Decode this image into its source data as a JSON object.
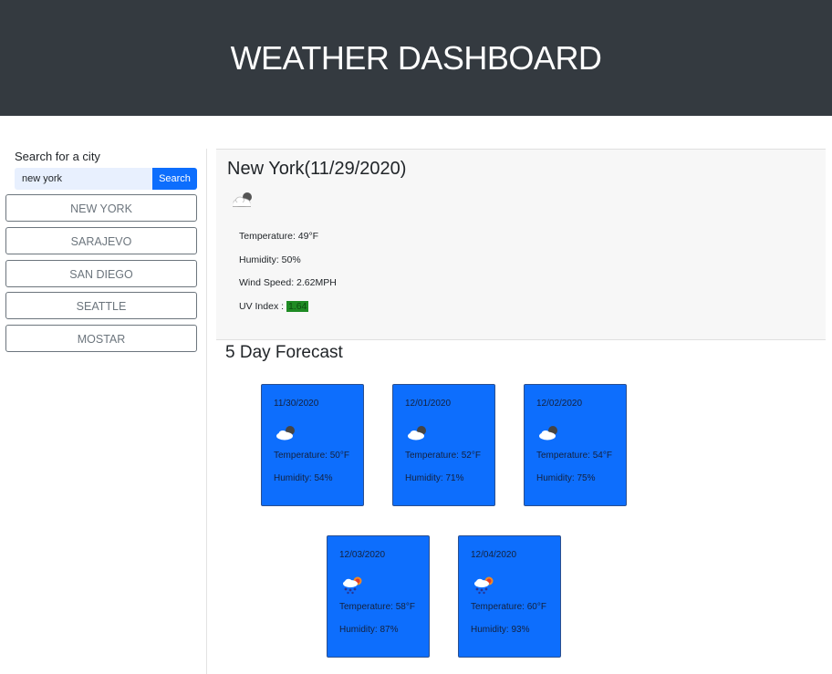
{
  "header": {
    "title": "WEATHER DASHBOARD"
  },
  "search": {
    "label": "Search for a city",
    "value": "new york",
    "button_label": "Search"
  },
  "history": [
    {
      "label": "NEW YORK"
    },
    {
      "label": "SARAJEVO"
    },
    {
      "label": "SAN DIEGO"
    },
    {
      "label": "SEATTLE"
    },
    {
      "label": "MOSTAR"
    }
  ],
  "current": {
    "title": "New York(11/29/2020)",
    "icon": "cloud-sun-icon",
    "temperature": "Temperature: 49°F",
    "humidity": "Humidity: 50%",
    "wind": "Wind Speed: 2.62MPH",
    "uv_label": "UV Index : ",
    "uv_value": "1.64",
    "uv_color": "#1f8b24"
  },
  "forecast": {
    "title": "5 Day Forecast",
    "card_color": "#0d6efd",
    "days": [
      {
        "date": "11/30/2020",
        "icon": "cloud-sun-icon",
        "temperature": "Temperature: 50°F",
        "humidity": "Humidity: 54%"
      },
      {
        "date": "12/01/2020",
        "icon": "cloud-sun-icon",
        "temperature": "Temperature: 52°F",
        "humidity": "Humidity: 71%"
      },
      {
        "date": "12/02/2020",
        "icon": "cloud-sun-icon",
        "temperature": "Temperature: 54°F",
        "humidity": "Humidity: 75%"
      },
      {
        "date": "12/03/2020",
        "icon": "rain-sun-icon",
        "temperature": "Temperature: 58°F",
        "humidity": "Humidity: 87%"
      },
      {
        "date": "12/04/2020",
        "icon": "rain-sun-icon",
        "temperature": "Temperature: 60°F",
        "humidity": "Humidity: 93%"
      }
    ]
  }
}
